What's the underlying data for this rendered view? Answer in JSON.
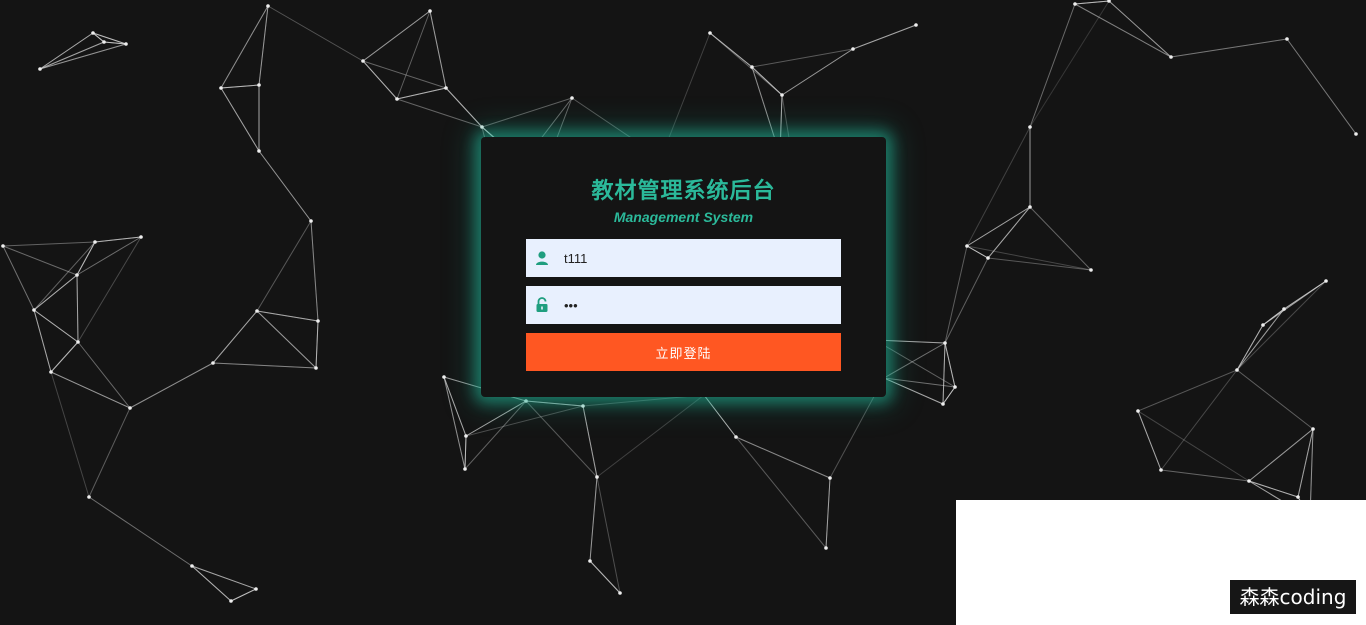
{
  "app": {
    "title_cn": "教材管理系统后台",
    "title_en": "Management System"
  },
  "login": {
    "username_value": "t111",
    "username_icon": "user-icon",
    "password_value": "111",
    "password_icon": "lock-icon",
    "submit_label": "立即登陆"
  },
  "watermark": {
    "text": "森森coding"
  },
  "colors": {
    "background": "#141414",
    "accent": "#2bb99a",
    "button": "#ff5722",
    "input_bg": "#e8f0fe",
    "network_line": "#d8d8d8"
  }
}
